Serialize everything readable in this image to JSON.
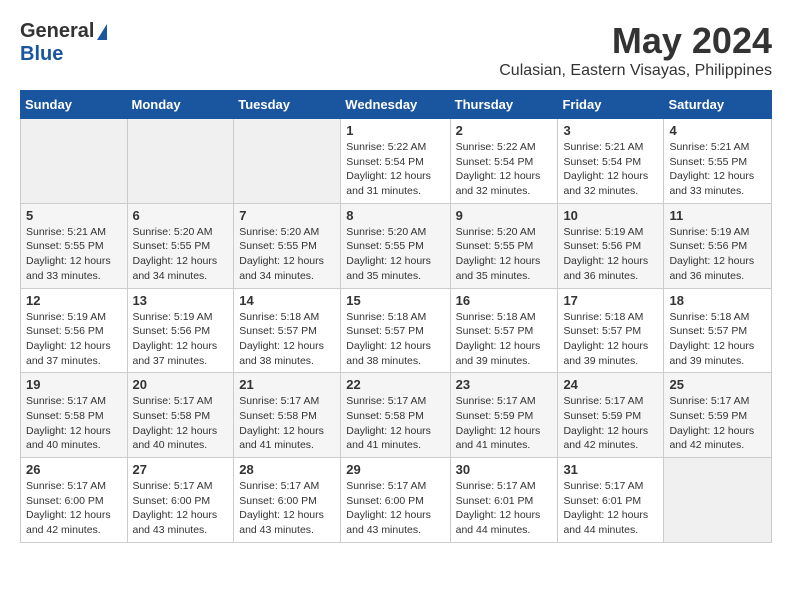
{
  "header": {
    "logo_general": "General",
    "logo_blue": "Blue",
    "month": "May 2024",
    "location": "Culasian, Eastern Visayas, Philippines"
  },
  "weekdays": [
    "Sunday",
    "Monday",
    "Tuesday",
    "Wednesday",
    "Thursday",
    "Friday",
    "Saturday"
  ],
  "weeks": [
    [
      {
        "day": "",
        "info": ""
      },
      {
        "day": "",
        "info": ""
      },
      {
        "day": "",
        "info": ""
      },
      {
        "day": "1",
        "info": "Sunrise: 5:22 AM\nSunset: 5:54 PM\nDaylight: 12 hours\nand 31 minutes."
      },
      {
        "day": "2",
        "info": "Sunrise: 5:22 AM\nSunset: 5:54 PM\nDaylight: 12 hours\nand 32 minutes."
      },
      {
        "day": "3",
        "info": "Sunrise: 5:21 AM\nSunset: 5:54 PM\nDaylight: 12 hours\nand 32 minutes."
      },
      {
        "day": "4",
        "info": "Sunrise: 5:21 AM\nSunset: 5:55 PM\nDaylight: 12 hours\nand 33 minutes."
      }
    ],
    [
      {
        "day": "5",
        "info": "Sunrise: 5:21 AM\nSunset: 5:55 PM\nDaylight: 12 hours\nand 33 minutes."
      },
      {
        "day": "6",
        "info": "Sunrise: 5:20 AM\nSunset: 5:55 PM\nDaylight: 12 hours\nand 34 minutes."
      },
      {
        "day": "7",
        "info": "Sunrise: 5:20 AM\nSunset: 5:55 PM\nDaylight: 12 hours\nand 34 minutes."
      },
      {
        "day": "8",
        "info": "Sunrise: 5:20 AM\nSunset: 5:55 PM\nDaylight: 12 hours\nand 35 minutes."
      },
      {
        "day": "9",
        "info": "Sunrise: 5:20 AM\nSunset: 5:55 PM\nDaylight: 12 hours\nand 35 minutes."
      },
      {
        "day": "10",
        "info": "Sunrise: 5:19 AM\nSunset: 5:56 PM\nDaylight: 12 hours\nand 36 minutes."
      },
      {
        "day": "11",
        "info": "Sunrise: 5:19 AM\nSunset: 5:56 PM\nDaylight: 12 hours\nand 36 minutes."
      }
    ],
    [
      {
        "day": "12",
        "info": "Sunrise: 5:19 AM\nSunset: 5:56 PM\nDaylight: 12 hours\nand 37 minutes."
      },
      {
        "day": "13",
        "info": "Sunrise: 5:19 AM\nSunset: 5:56 PM\nDaylight: 12 hours\nand 37 minutes."
      },
      {
        "day": "14",
        "info": "Sunrise: 5:18 AM\nSunset: 5:57 PM\nDaylight: 12 hours\nand 38 minutes."
      },
      {
        "day": "15",
        "info": "Sunrise: 5:18 AM\nSunset: 5:57 PM\nDaylight: 12 hours\nand 38 minutes."
      },
      {
        "day": "16",
        "info": "Sunrise: 5:18 AM\nSunset: 5:57 PM\nDaylight: 12 hours\nand 39 minutes."
      },
      {
        "day": "17",
        "info": "Sunrise: 5:18 AM\nSunset: 5:57 PM\nDaylight: 12 hours\nand 39 minutes."
      },
      {
        "day": "18",
        "info": "Sunrise: 5:18 AM\nSunset: 5:57 PM\nDaylight: 12 hours\nand 39 minutes."
      }
    ],
    [
      {
        "day": "19",
        "info": "Sunrise: 5:17 AM\nSunset: 5:58 PM\nDaylight: 12 hours\nand 40 minutes."
      },
      {
        "day": "20",
        "info": "Sunrise: 5:17 AM\nSunset: 5:58 PM\nDaylight: 12 hours\nand 40 minutes."
      },
      {
        "day": "21",
        "info": "Sunrise: 5:17 AM\nSunset: 5:58 PM\nDaylight: 12 hours\nand 41 minutes."
      },
      {
        "day": "22",
        "info": "Sunrise: 5:17 AM\nSunset: 5:58 PM\nDaylight: 12 hours\nand 41 minutes."
      },
      {
        "day": "23",
        "info": "Sunrise: 5:17 AM\nSunset: 5:59 PM\nDaylight: 12 hours\nand 41 minutes."
      },
      {
        "day": "24",
        "info": "Sunrise: 5:17 AM\nSunset: 5:59 PM\nDaylight: 12 hours\nand 42 minutes."
      },
      {
        "day": "25",
        "info": "Sunrise: 5:17 AM\nSunset: 5:59 PM\nDaylight: 12 hours\nand 42 minutes."
      }
    ],
    [
      {
        "day": "26",
        "info": "Sunrise: 5:17 AM\nSunset: 6:00 PM\nDaylight: 12 hours\nand 42 minutes."
      },
      {
        "day": "27",
        "info": "Sunrise: 5:17 AM\nSunset: 6:00 PM\nDaylight: 12 hours\nand 43 minutes."
      },
      {
        "day": "28",
        "info": "Sunrise: 5:17 AM\nSunset: 6:00 PM\nDaylight: 12 hours\nand 43 minutes."
      },
      {
        "day": "29",
        "info": "Sunrise: 5:17 AM\nSunset: 6:00 PM\nDaylight: 12 hours\nand 43 minutes."
      },
      {
        "day": "30",
        "info": "Sunrise: 5:17 AM\nSunset: 6:01 PM\nDaylight: 12 hours\nand 44 minutes."
      },
      {
        "day": "31",
        "info": "Sunrise: 5:17 AM\nSunset: 6:01 PM\nDaylight: 12 hours\nand 44 minutes."
      },
      {
        "day": "",
        "info": ""
      }
    ]
  ]
}
